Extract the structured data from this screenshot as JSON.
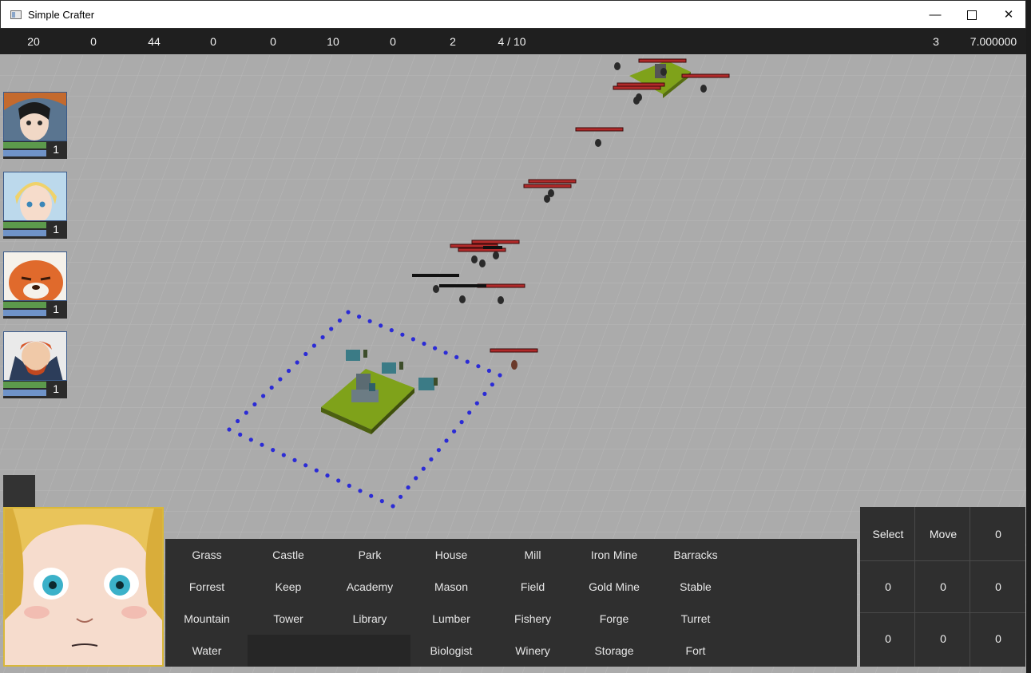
{
  "window": {
    "title": "Simple Crafter",
    "min_icon": "minimize-icon",
    "max_icon": "maximize-icon",
    "close_icon": "close-icon"
  },
  "stats": [
    "20",
    "0",
    "44",
    "0",
    "0",
    "10",
    "0",
    "2",
    "4 / 10"
  ],
  "stats_right": [
    "3",
    "7.000000"
  ],
  "party": [
    {
      "level": "1",
      "health": 1.0,
      "mana": 1.0
    },
    {
      "level": "1",
      "health": 1.0,
      "mana": 1.0
    },
    {
      "level": "1",
      "health": 1.0,
      "mana": 1.0
    },
    {
      "level": "1",
      "health": 1.0,
      "mana": 1.0
    }
  ],
  "build_menu": [
    [
      "Grass",
      "Castle",
      "Park",
      "House",
      "Mill",
      "Iron Mine",
      "Barracks"
    ],
    [
      "Forrest",
      "Keep",
      "Academy",
      "Mason",
      "Field",
      "Gold Mine",
      "Stable"
    ],
    [
      "Mountain",
      "Tower",
      "Library",
      "Lumber",
      "Fishery",
      "Forge",
      "Turret"
    ],
    [
      "Water",
      "",
      "",
      "Biologist",
      "Winery",
      "Storage",
      "Fort"
    ]
  ],
  "command_panel": [
    [
      "Select",
      "Move",
      "0"
    ],
    [
      "0",
      "0",
      "0"
    ],
    [
      "0",
      "0",
      "0"
    ]
  ],
  "colors": {
    "ground": "#ababab",
    "grid": "#b8b8b8",
    "health_bar": "#b12a2a",
    "territory_dot": "#2b2bd6",
    "grass_tile": "#7fa21a",
    "portrait_border": "#d9b83a"
  }
}
